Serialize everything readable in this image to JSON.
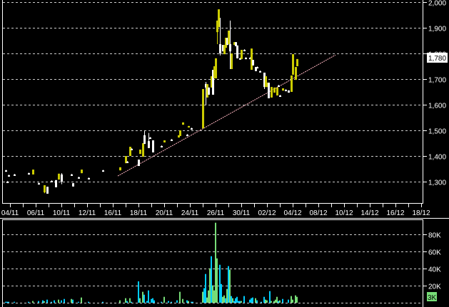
{
  "chart_data": [
    {
      "type": "candlestick",
      "title": "",
      "xlabel": "",
      "ylabel": "",
      "ylim": [
        1250,
        2000
      ],
      "grid": true,
      "y_ticks": [
        "2,000",
        "1,900",
        "1,800",
        "1,700",
        "1,600",
        "1,500",
        "1,400",
        "1,300"
      ],
      "y_tick_values": [
        2000,
        1900,
        1800,
        1700,
        1600,
        1500,
        1400,
        1300
      ],
      "x_tick_labels": [
        "04/11",
        "06/11",
        "10/11",
        "12/11",
        "16/11",
        "18/11",
        "20/11",
        "24/11",
        "26/11",
        "30/11",
        "02/12",
        "04/12",
        "08/12",
        "10/12",
        "14/12",
        "16/12",
        "18/12"
      ],
      "last_price_label": "1,780",
      "last_price": 1780,
      "colors": {
        "up": "#cccc00",
        "down": "#ffffff",
        "trendline": "#ffb6c1",
        "grid": "#cccccc"
      },
      "trendline": {
        "start": {
          "bar": 80.5,
          "price": 1322
        },
        "end": {
          "bar": 233,
          "price": 1794
        }
      },
      "candles_fields": [
        "bar",
        "open",
        "high",
        "low",
        "close"
      ],
      "candles": [
        [
          2,
          1344,
          1346,
          1342,
          1344
        ],
        [
          3,
          1300,
          1302,
          1298,
          1300
        ],
        [
          4,
          1325,
          1327,
          1323,
          1325
        ],
        [
          8,
          1328,
          1330,
          1326,
          1328
        ],
        [
          18,
          1333,
          1335,
          1331,
          1333
        ],
        [
          21,
          1328,
          1347,
          1328,
          1347
        ],
        [
          25,
          1294,
          1296,
          1292,
          1294
        ],
        [
          29,
          1258,
          1286,
          1255,
          1286
        ],
        [
          31,
          1280,
          1280,
          1253,
          1253
        ],
        [
          34,
          1303,
          1305,
          1301,
          1303
        ],
        [
          37,
          1306,
          1306,
          1278,
          1278
        ],
        [
          39,
          1308,
          1331,
          1308,
          1331
        ],
        [
          41,
          1328,
          1333,
          1290,
          1300
        ],
        [
          48,
          1328,
          1330,
          1326,
          1328
        ],
        [
          49,
          1294,
          1294,
          1281,
          1281
        ],
        [
          53,
          1317,
          1319,
          1315,
          1317
        ],
        [
          55,
          1333,
          1347,
          1333,
          1347
        ],
        [
          60,
          1314,
          1316,
          1312,
          1314
        ],
        [
          70,
          1344,
          1346,
          1342,
          1344
        ],
        [
          82,
          1344,
          1356,
          1344,
          1356
        ],
        [
          86,
          1372,
          1400,
          1372,
          1400
        ],
        [
          87,
          1378,
          1380,
          1376,
          1378
        ],
        [
          89,
          1400,
          1436,
          1400,
          1436
        ],
        [
          90,
          1428,
          1430,
          1426,
          1428
        ],
        [
          95,
          1386,
          1386,
          1361,
          1361
        ],
        [
          96,
          1408,
          1425,
          1408,
          1425
        ],
        [
          98,
          1397,
          1450,
          1397,
          1450
        ],
        [
          99,
          1481,
          1500,
          1447,
          1447
        ],
        [
          102,
          1458,
          1490,
          1431,
          1431
        ],
        [
          103,
          1472,
          1474,
          1470,
          1472
        ],
        [
          105,
          1461,
          1461,
          1414,
          1414
        ],
        [
          111,
          1439,
          1441,
          1437,
          1439
        ],
        [
          113,
          1453,
          1461,
          1453,
          1461
        ],
        [
          118,
          1464,
          1466,
          1462,
          1464
        ],
        [
          123,
          1472,
          1481,
          1472,
          1481
        ],
        [
          124,
          1478,
          1500,
          1478,
          1500
        ],
        [
          126,
          1522,
          1531,
          1522,
          1531
        ],
        [
          129,
          1483,
          1485,
          1481,
          1483
        ],
        [
          130,
          1511,
          1517,
          1511,
          1517
        ],
        [
          132,
          1508,
          1510,
          1506,
          1508
        ],
        [
          140,
          1508,
          1661,
          1508,
          1661
        ],
        [
          142,
          1681,
          1689,
          1600,
          1667
        ],
        [
          143,
          1628,
          1680,
          1628,
          1680
        ],
        [
          144,
          1667,
          1667,
          1639,
          1639
        ],
        [
          146,
          1667,
          1711,
          1667,
          1711
        ],
        [
          147,
          1736,
          1736,
          1639,
          1639
        ],
        [
          148,
          1703,
          1750,
          1703,
          1750
        ],
        [
          149,
          1703,
          1781,
          1703,
          1781
        ],
        [
          150,
          1883,
          1928,
          1836,
          1928
        ],
        [
          151,
          1903,
          1972,
          1903,
          1972
        ],
        [
          152,
          1836,
          1939,
          1792,
          1800
        ],
        [
          154,
          1833,
          1833,
          1808,
          1808
        ],
        [
          155,
          1797,
          1833,
          1797,
          1833
        ],
        [
          156,
          1822,
          1861,
          1822,
          1861
        ],
        [
          157,
          1861,
          1861,
          1833,
          1833
        ],
        [
          158,
          1836,
          1889,
          1836,
          1889
        ],
        [
          159,
          1836,
          1928,
          1739,
          1808
        ],
        [
          160,
          1739,
          1800,
          1739,
          1800
        ],
        [
          162,
          1833,
          1844,
          1833,
          1844
        ],
        [
          163,
          1844,
          1844,
          1828,
          1828
        ],
        [
          164,
          1831,
          1831,
          1781,
          1781
        ],
        [
          166,
          1781,
          1783,
          1779,
          1781
        ],
        [
          167,
          1778,
          1814,
          1778,
          1814
        ],
        [
          169,
          1814,
          1816,
          1812,
          1814
        ],
        [
          170,
          1783,
          1785,
          1781,
          1783
        ],
        [
          173,
          1783,
          1785,
          1781,
          1783
        ],
        [
          174,
          1736,
          1819,
          1736,
          1819
        ],
        [
          175,
          1775,
          1775,
          1753,
          1753
        ],
        [
          177,
          1747,
          1747,
          1731,
          1731
        ],
        [
          178,
          1747,
          1749,
          1745,
          1747
        ],
        [
          180,
          1731,
          1733,
          1729,
          1731
        ],
        [
          183,
          1725,
          1725,
          1661,
          1669
        ],
        [
          184,
          1669,
          1711,
          1669,
          1711
        ],
        [
          185,
          1669,
          1686,
          1669,
          1686
        ],
        [
          186,
          1686,
          1686,
          1625,
          1625
        ],
        [
          188,
          1628,
          1669,
          1628,
          1669
        ],
        [
          190,
          1647,
          1667,
          1647,
          1667
        ],
        [
          192,
          1636,
          1667,
          1636,
          1667
        ],
        [
          193,
          1675,
          1677,
          1673,
          1675
        ],
        [
          194,
          1636,
          1638,
          1634,
          1636
        ],
        [
          196,
          1655,
          1664,
          1655,
          1664
        ],
        [
          198,
          1658,
          1660,
          1656,
          1658
        ],
        [
          200,
          1656,
          1656,
          1647,
          1647
        ],
        [
          202,
          1650,
          1714,
          1650,
          1714
        ],
        [
          203,
          1717,
          1797,
          1717,
          1797
        ],
        [
          205,
          1697,
          1747,
          1697,
          1747
        ],
        [
          206,
          1750,
          1778,
          1750,
          1778
        ]
      ]
    },
    {
      "type": "bar",
      "title": "Volume",
      "ylim": [
        0,
        90000
      ],
      "grid": true,
      "y_ticks": [
        "80K",
        "60K",
        "40K",
        "20K"
      ],
      "y_tick_values": [
        80,
        60,
        40,
        20
      ],
      "last_volume_label": "3K",
      "colors": {
        "up": "#77dd77",
        "down": "#00ccff"
      },
      "volume_fields": [
        "bar",
        "volume_k",
        "up"
      ],
      "volume": [
        [
          2,
          1.1,
          0
        ],
        [
          3,
          1.1,
          0
        ],
        [
          4,
          1.1,
          0
        ],
        [
          8,
          1.1,
          0
        ],
        [
          18,
          1.1,
          0
        ],
        [
          21,
          2,
          1
        ],
        [
          25,
          2,
          0
        ],
        [
          28,
          2.8,
          0
        ],
        [
          29,
          1.7,
          1
        ],
        [
          31,
          3.6,
          0
        ],
        [
          34,
          1.1,
          0
        ],
        [
          36,
          2.8,
          0
        ],
        [
          39,
          3.6,
          1
        ],
        [
          41,
          2.8,
          0
        ],
        [
          43,
          4.4,
          0
        ],
        [
          48,
          4.4,
          1
        ],
        [
          49,
          3.6,
          0
        ],
        [
          53,
          1.1,
          0
        ],
        [
          55,
          6.1,
          1
        ],
        [
          60,
          1.1,
          0
        ],
        [
          70,
          1.1,
          0
        ],
        [
          82,
          2.8,
          1
        ],
        [
          86,
          5.3,
          1
        ],
        [
          87,
          2,
          0
        ],
        [
          89,
          5.3,
          1
        ],
        [
          90,
          1.1,
          0
        ],
        [
          95,
          25,
          0
        ],
        [
          96,
          5.3,
          1
        ],
        [
          98,
          12.8,
          1
        ],
        [
          99,
          9.4,
          0
        ],
        [
          101,
          2,
          0
        ],
        [
          102,
          14.4,
          0
        ],
        [
          104,
          4.4,
          0
        ],
        [
          105,
          5.3,
          0
        ],
        [
          106,
          2.8,
          0
        ],
        [
          111,
          1.1,
          0
        ],
        [
          113,
          6.9,
          1
        ],
        [
          116,
          2,
          0
        ],
        [
          118,
          1.1,
          0
        ],
        [
          122,
          2.8,
          0
        ],
        [
          124,
          12.8,
          1
        ],
        [
          126,
          4.4,
          1
        ],
        [
          129,
          2.8,
          0
        ],
        [
          130,
          2,
          1
        ],
        [
          132,
          1.1,
          0
        ],
        [
          133,
          1.1,
          0
        ],
        [
          140,
          12.8,
          1
        ],
        [
          141,
          17,
          0
        ],
        [
          142,
          33.6,
          0
        ],
        [
          143,
          6.1,
          1
        ],
        [
          144,
          14.4,
          1
        ],
        [
          145,
          40.3,
          1
        ],
        [
          146,
          54.4,
          0
        ],
        [
          147,
          20.3,
          1
        ],
        [
          148,
          14.4,
          1
        ],
        [
          149,
          93.6,
          1
        ],
        [
          150,
          51.9,
          1
        ],
        [
          152,
          44.4,
          0
        ],
        [
          153,
          21.9,
          0
        ],
        [
          154,
          6.9,
          1
        ],
        [
          155,
          8.6,
          1
        ],
        [
          156,
          5.3,
          0
        ],
        [
          157,
          16.1,
          1
        ],
        [
          158,
          42.8,
          0
        ],
        [
          159,
          38.6,
          1
        ],
        [
          160,
          7.8,
          0
        ],
        [
          161,
          5.3,
          1
        ],
        [
          162,
          2,
          0
        ],
        [
          163,
          5.3,
          0
        ],
        [
          164,
          6.9,
          0
        ],
        [
          165,
          2,
          0
        ],
        [
          166,
          2,
          0
        ],
        [
          167,
          2,
          1
        ],
        [
          169,
          7.8,
          0
        ],
        [
          173,
          3.6,
          0
        ],
        [
          174,
          5.3,
          0
        ],
        [
          175,
          6.1,
          0
        ],
        [
          177,
          5.3,
          1
        ],
        [
          178,
          2.8,
          0
        ],
        [
          181,
          1.1,
          0
        ],
        [
          183,
          6.9,
          0
        ],
        [
          184,
          3.6,
          1
        ],
        [
          185,
          2.8,
          1
        ],
        [
          187,
          13.6,
          0
        ],
        [
          188,
          2,
          1
        ],
        [
          190,
          2,
          1
        ],
        [
          191,
          3.6,
          1
        ],
        [
          192,
          6.9,
          1
        ],
        [
          193,
          2,
          0
        ],
        [
          194,
          2.8,
          1
        ],
        [
          196,
          4.4,
          0
        ],
        [
          200,
          3.6,
          0
        ],
        [
          202,
          7.8,
          1
        ],
        [
          203,
          3.6,
          1
        ],
        [
          205,
          8.6,
          1
        ],
        [
          206,
          6.9,
          1
        ]
      ]
    }
  ]
}
